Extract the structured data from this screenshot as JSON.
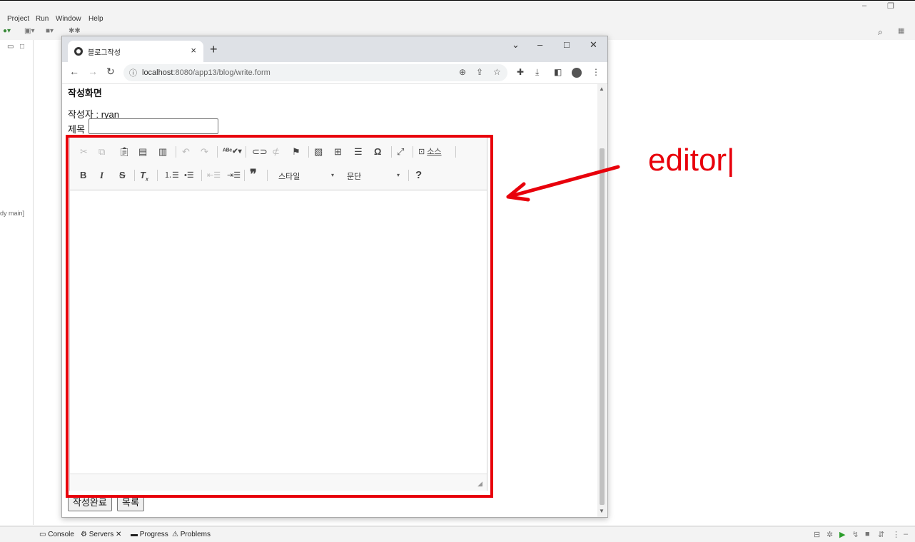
{
  "ide": {
    "menu": [
      "Project",
      "Run",
      "Window",
      "Help"
    ],
    "left_label": "dy main]",
    "bottom_tabs": [
      "Console",
      "Servers",
      "Progress",
      "Problems"
    ]
  },
  "browser": {
    "tab_title": "블로그작성",
    "url_host": "localhost",
    "url_path": ":8080/app13/blog/write.form"
  },
  "page": {
    "heading": "작성화면",
    "writer_label": "작성자 : ryan",
    "subject_label": "제목",
    "subject_value": "",
    "submit_button": "작성완료",
    "list_button": "목록"
  },
  "editor": {
    "source_label": "소스",
    "style_combo": "스타일",
    "paragraph_combo": "문단"
  },
  "annotation": {
    "text": "editor|",
    "color": "#e8000b"
  }
}
